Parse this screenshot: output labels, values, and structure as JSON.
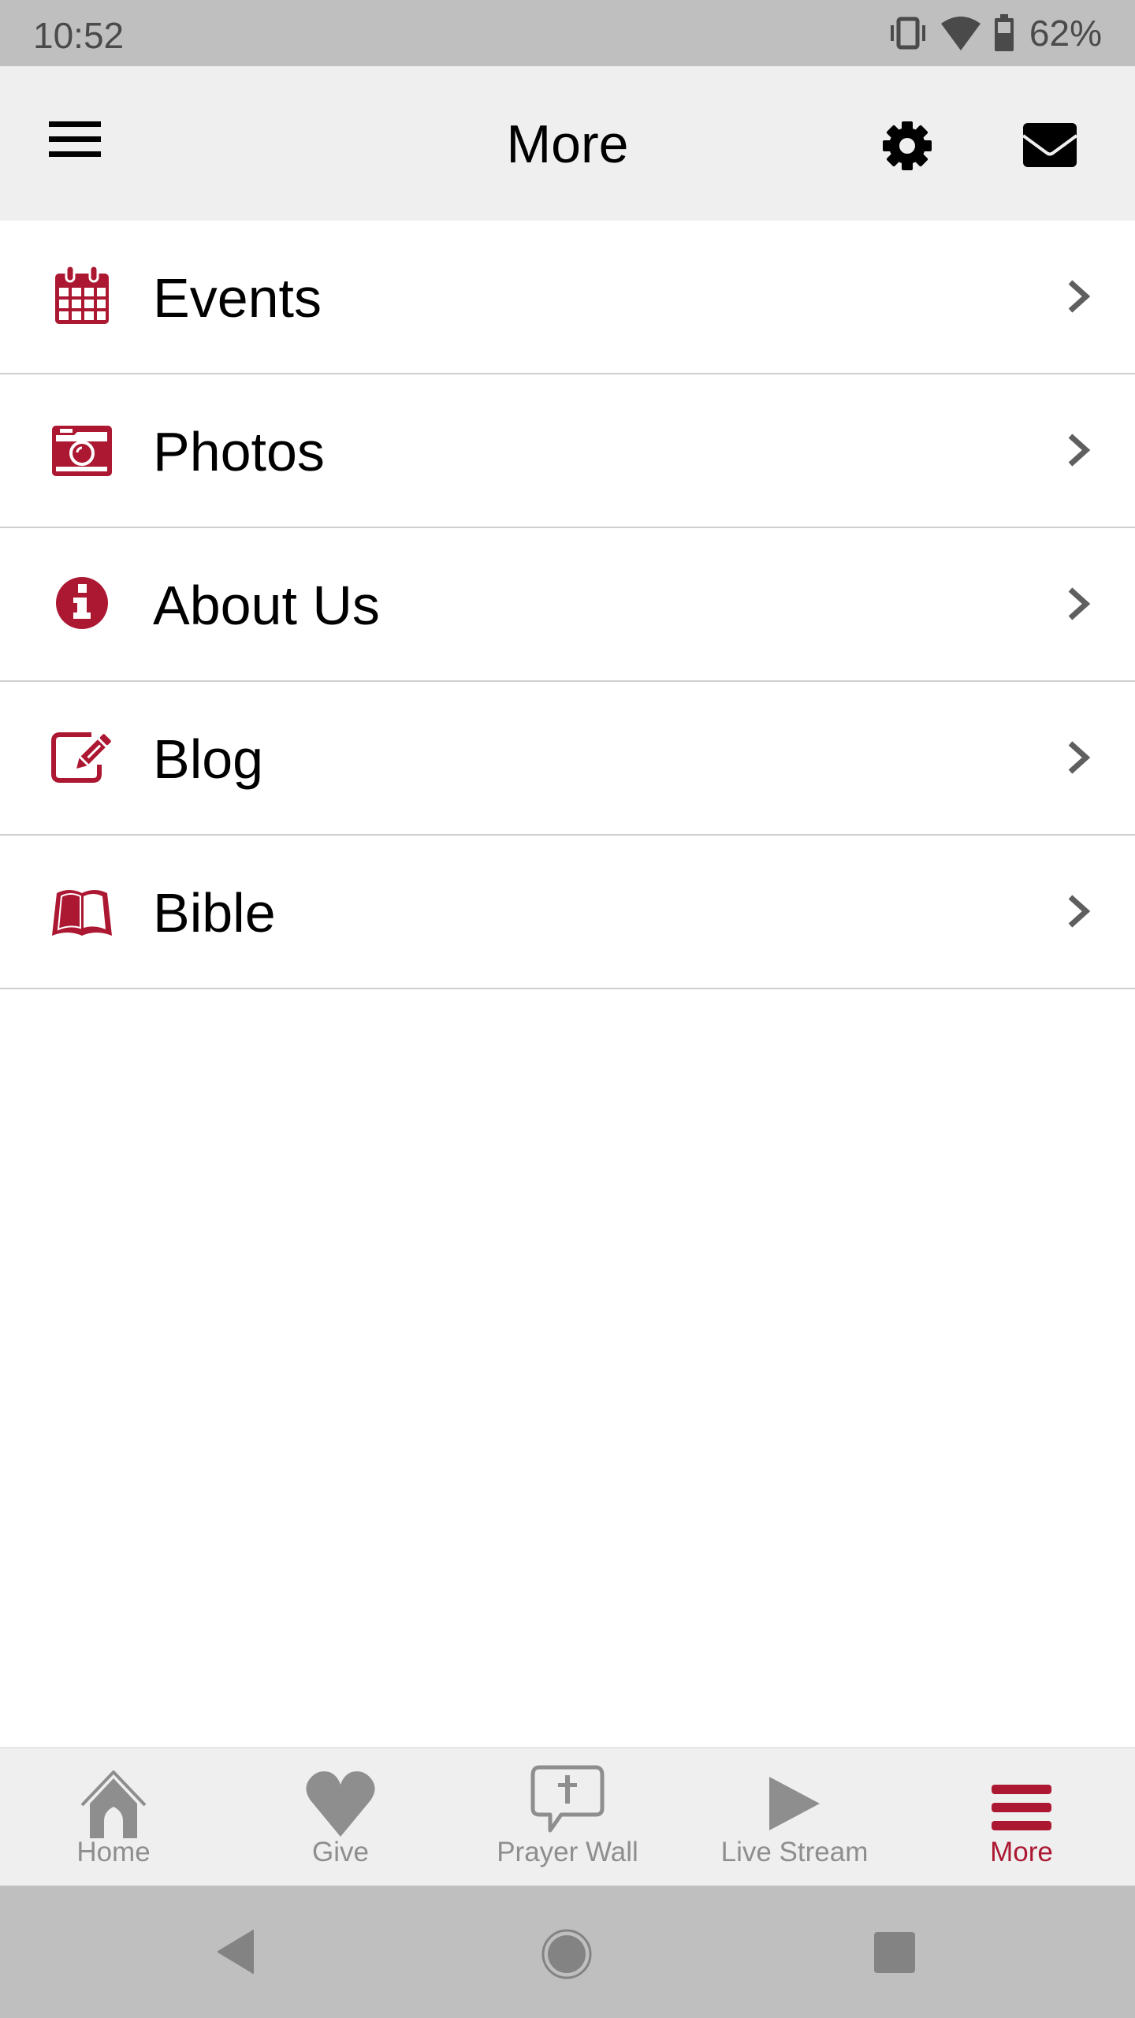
{
  "status_bar": {
    "time": "10:52",
    "battery_percent": "62%",
    "icons": [
      "vibrate-icon",
      "wifi-icon",
      "battery-icon"
    ]
  },
  "header": {
    "title": "More",
    "left_icon": "hamburger-menu-icon",
    "right_icons": [
      "gear-icon",
      "mail-icon"
    ]
  },
  "menu": {
    "items": [
      {
        "label": "Events",
        "icon": "calendar-icon"
      },
      {
        "label": "Photos",
        "icon": "camera-icon"
      },
      {
        "label": "About Us",
        "icon": "info-icon"
      },
      {
        "label": "Blog",
        "icon": "edit-icon"
      },
      {
        "label": "Bible",
        "icon": "book-icon"
      }
    ]
  },
  "tab_bar": {
    "active": "More",
    "tabs": [
      {
        "label": "Home",
        "icon": "home-icon"
      },
      {
        "label": "Give",
        "icon": "heart-icon"
      },
      {
        "label": "Prayer Wall",
        "icon": "prayer-bubble-icon"
      },
      {
        "label": "Live Stream",
        "icon": "play-icon"
      },
      {
        "label": "More",
        "icon": "menu-icon"
      }
    ]
  },
  "colors": {
    "accent": "#ac1832",
    "inactive": "#8e8e8e",
    "header_bg": "#efefef",
    "status_bg": "#bfbfbf"
  }
}
